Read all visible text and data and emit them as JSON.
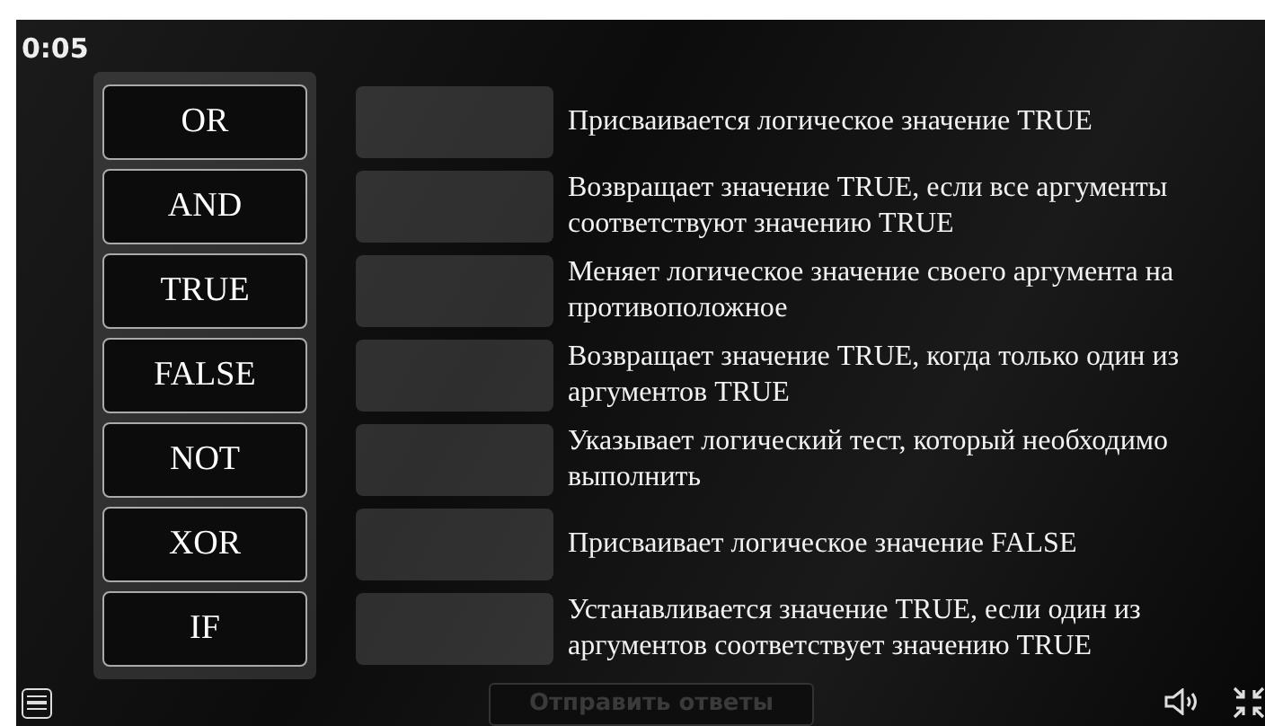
{
  "timer": "0:05",
  "terms": [
    {
      "label": "OR"
    },
    {
      "label": "AND"
    },
    {
      "label": "TRUE"
    },
    {
      "label": "FALSE"
    },
    {
      "label": "NOT"
    },
    {
      "label": "XOR"
    },
    {
      "label": "IF"
    }
  ],
  "definitions": [
    {
      "text": "Присваивается логическое значение TRUE"
    },
    {
      "text": "Возвращает значение TRUE, если все аргументы соответствуют значению TRUE"
    },
    {
      "text": "Меняет логическое значение своего аргумента на противоположное"
    },
    {
      "text": "Возвращает значение TRUE, когда только один из аргументов TRUE"
    },
    {
      "text": "Указывает логический тест, который необходимо выполнить"
    },
    {
      "text": "Присваивает логическое значение FALSE"
    },
    {
      "text": "Устанавливается значение TRUE, если один из аргументов соответствует значению TRUE"
    }
  ],
  "submit_button": {
    "label": "Отправить ответы",
    "disabled": true
  }
}
